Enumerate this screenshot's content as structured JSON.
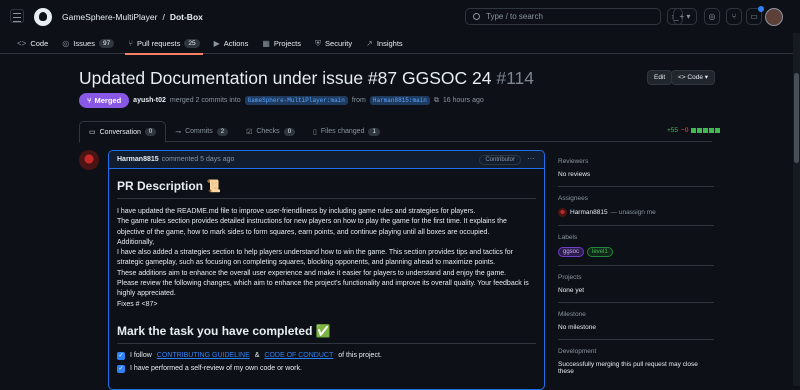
{
  "header": {
    "owner": "GameSphere-MultiPlayer",
    "sep": "/",
    "repo": "Dot-Box",
    "search_placeholder": "Type / to search",
    "search_key": "/"
  },
  "repo_tabs": [
    {
      "icon": "<>",
      "label": "Code",
      "count": null
    },
    {
      "icon": "◎",
      "label": "Issues",
      "count": "97"
    },
    {
      "icon": "⑂",
      "label": "Pull requests",
      "count": "25"
    },
    {
      "icon": "▶",
      "label": "Actions",
      "count": null
    },
    {
      "icon": "▦",
      "label": "Projects",
      "count": null
    },
    {
      "icon": "⛨",
      "label": "Security",
      "count": null
    },
    {
      "icon": "↗",
      "label": "Insights",
      "count": null
    }
  ],
  "pr": {
    "title": "Updated Documentation under issue #87 GGSOC 24",
    "number": "#114",
    "edit_label": "Edit",
    "code_label": "<> Code ▾",
    "state": "Merged",
    "author": "ayush-t02",
    "merge_text": "merged 2 commits into",
    "base_branch": "GameSphere-MultiPlayer:main",
    "from_text": "from",
    "head_branch": "Harman8815:main",
    "time": "16 hours ago"
  },
  "pr_tabs": [
    {
      "icon": "▭",
      "label": "Conversation",
      "count": "0"
    },
    {
      "icon": "⊸",
      "label": "Commits",
      "count": "2"
    },
    {
      "icon": "☑",
      "label": "Checks",
      "count": "0"
    },
    {
      "icon": "▯",
      "label": "Files changed",
      "count": "1"
    }
  ],
  "diff": {
    "add": "+55",
    "del": "−0"
  },
  "comment": {
    "user": "Harman8815",
    "when": "commented 5 days ago",
    "role": "Contributor",
    "heading": "PR Description 📜",
    "body": "I have updated the README.md file to improve user-friendliness by including game rules and strategies for players.\nThe game rules section provides detailed instructions for new players on how to play the game for the first time. It explains the objective of the game, how to mark sides to form squares, earn points, and continue playing until all boxes are occupied.\nAdditionally,\nI have also added a strategies section to help players understand how to win the game. This section provides tips and tactics for strategic gameplay, such as focusing on completing squares, blocking opponents, and planning ahead to maximize points.\nThese additions aim to enhance the overall user experience and make it easier for players to understand and enjoy the game.\nPlease review the following changes, which aim to enhance the project's functionality and improve its overall quality. Your feedback is highly appreciated.\nFixes # <87>",
    "heading2": "Mark the task you have completed ✅",
    "task1_pre": "I follow",
    "task1_link1": "CONTRIBUTING GUIDELINE",
    "task1_amp": "&",
    "task1_link2": "CODE OF CONDUCT",
    "task1_post": "of this project.",
    "task2": "I have performed a self-review of my own code or work."
  },
  "sidebar": {
    "reviewers_label": "Reviewers",
    "reviewers_val": "No reviews",
    "assignees_label": "Assignees",
    "assignee": "Harman8815",
    "unassign": "— unassign me",
    "labels_label": "Labels",
    "label1": "ggsoc",
    "label2": "level1",
    "projects_label": "Projects",
    "projects_val": "None yet",
    "milestone_label": "Milestone",
    "milestone_val": "No milestone",
    "development_label": "Development",
    "development_val": "Successfully merging this pull request may close these"
  }
}
